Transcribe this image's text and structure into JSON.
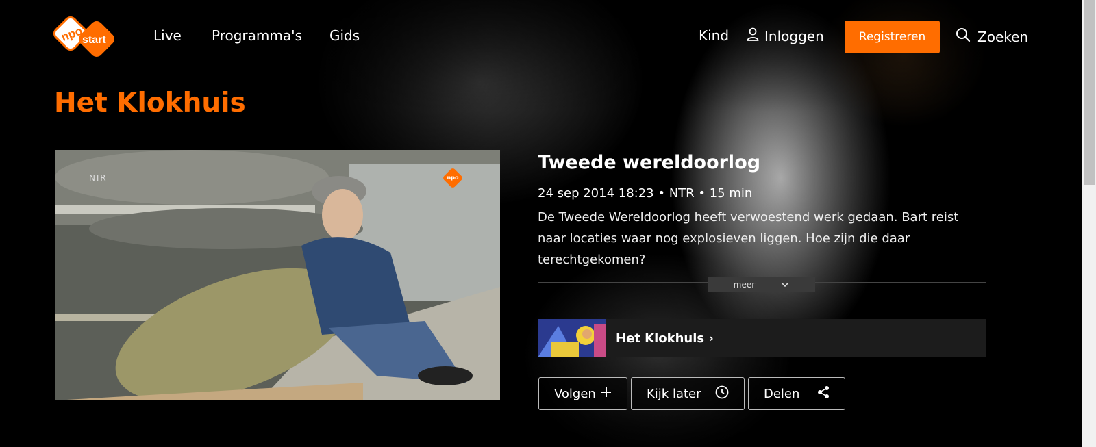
{
  "brand": {
    "logo_text_top": "npo",
    "logo_text_bottom": "start",
    "accent": "#ff6d00"
  },
  "nav": {
    "live": "Live",
    "programmas": "Programma's",
    "gids": "Gids",
    "kind": "Kind",
    "login": "Inloggen",
    "register": "Registreren",
    "search": "Zoeken"
  },
  "program": {
    "title": "Het Klokhuis"
  },
  "video": {
    "watermark": "NTR",
    "badge": "npo"
  },
  "episode": {
    "title": "Tweede wereldoorlog",
    "meta": "24 sep 2014 18:23 • NTR • 15 min",
    "description": "De Tweede Wereldoorlog heeft verwoestend werk gedaan. Bart reist naar locaties waar nog explosieven liggen. Hoe zijn die daar terechtgekomen?",
    "more_label": "meer"
  },
  "series_link": {
    "label": "Het Klokhuis ›"
  },
  "actions": {
    "follow": "Volgen",
    "watch_later": "Kijk later",
    "share": "Delen"
  },
  "icons": {
    "user": "user-icon",
    "search": "search-icon",
    "plus": "plus-icon",
    "clock": "clock-icon",
    "share": "share-icon",
    "chevron": "chevron-down-icon"
  }
}
